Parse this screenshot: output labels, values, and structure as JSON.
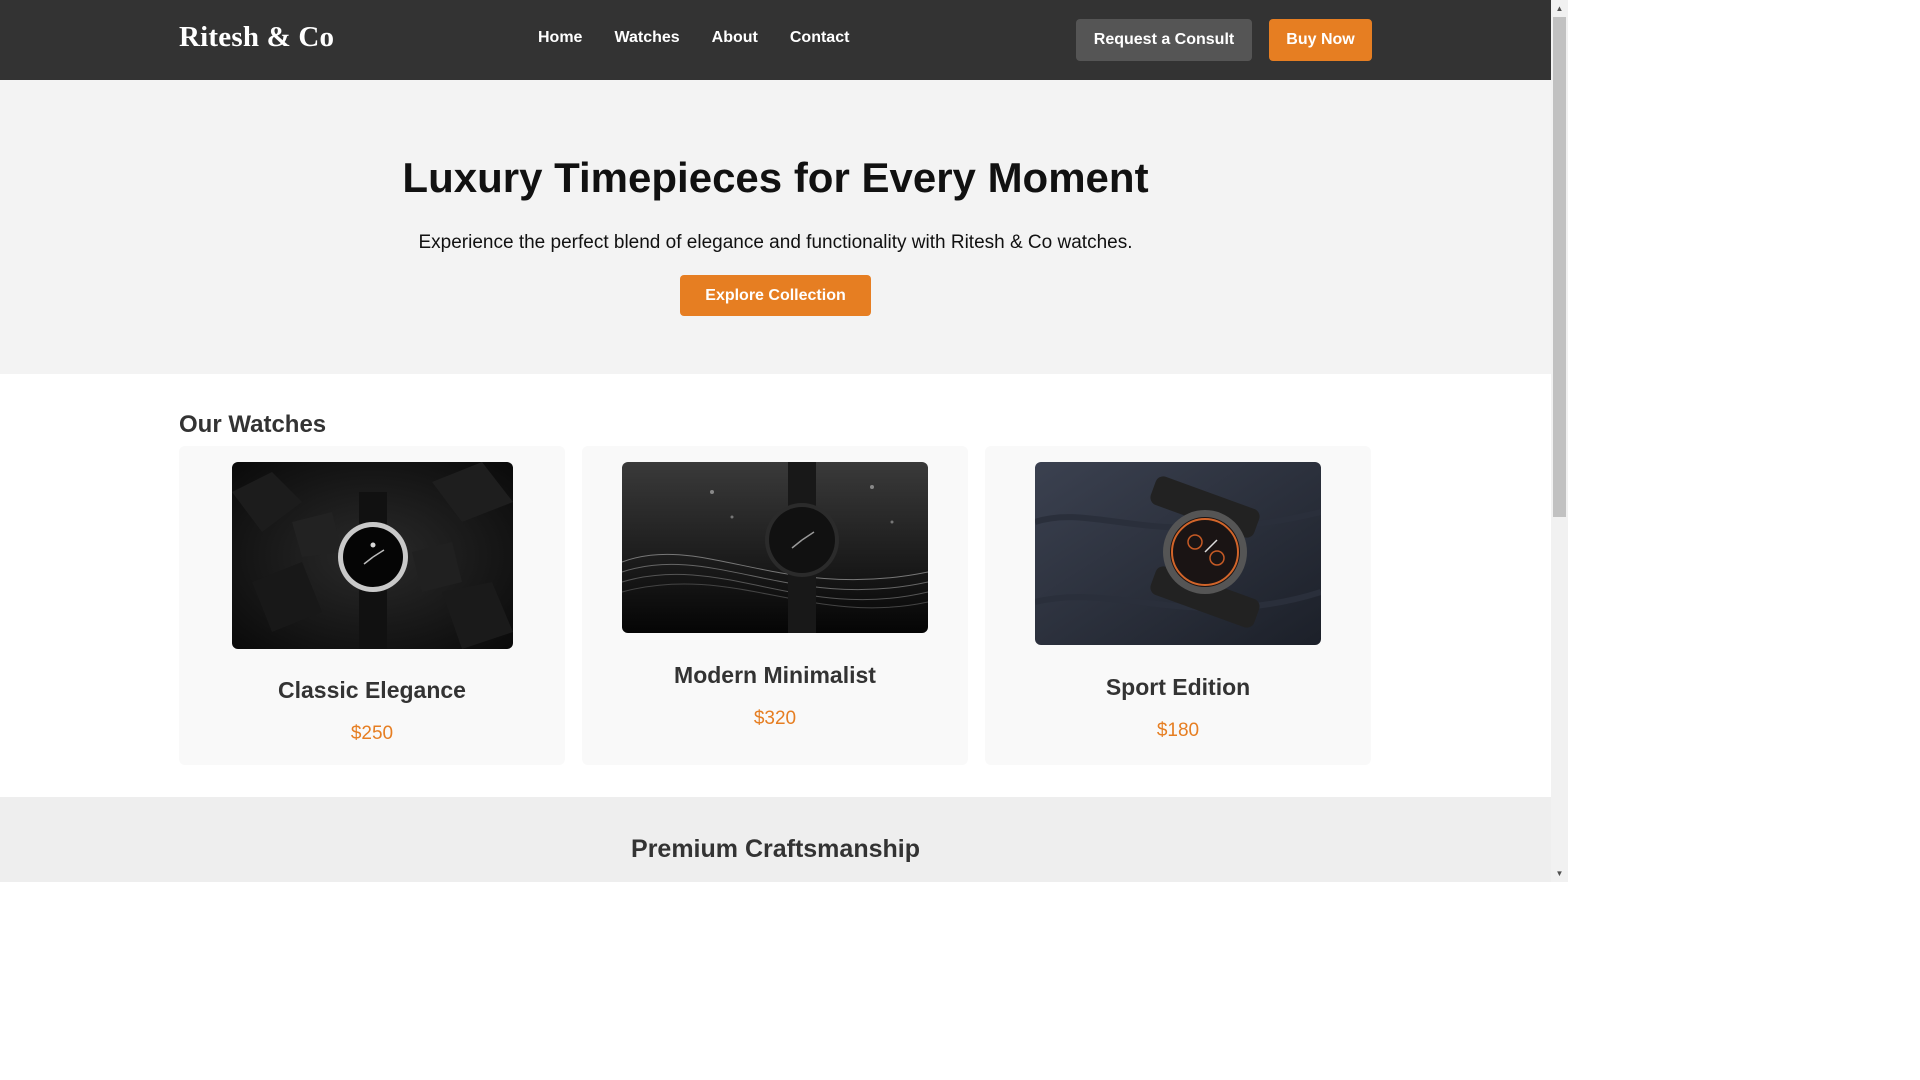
{
  "header": {
    "logo": "Ritesh & Co",
    "nav": [
      "Home",
      "Watches",
      "About",
      "Contact"
    ],
    "consult_label": "Request a Consult",
    "buy_label": "Buy Now"
  },
  "hero": {
    "title": "Luxury Timepieces for Every Moment",
    "subtitle": "Experience the perfect blend of elegance and functionality with Ritesh & Co watches.",
    "cta_label": "Explore Collection"
  },
  "watches": {
    "title": "Our Watches",
    "items": [
      {
        "name": "Classic Elegance",
        "price": "$250"
      },
      {
        "name": "Modern Minimalist",
        "price": "$320"
      },
      {
        "name": "Sport Edition",
        "price": "$180"
      }
    ]
  },
  "craftsmanship": {
    "title": "Premium Craftsmanship"
  },
  "colors": {
    "header_bg": "#333333",
    "accent": "#e67e22",
    "hero_bg": "#f3f3f3"
  }
}
